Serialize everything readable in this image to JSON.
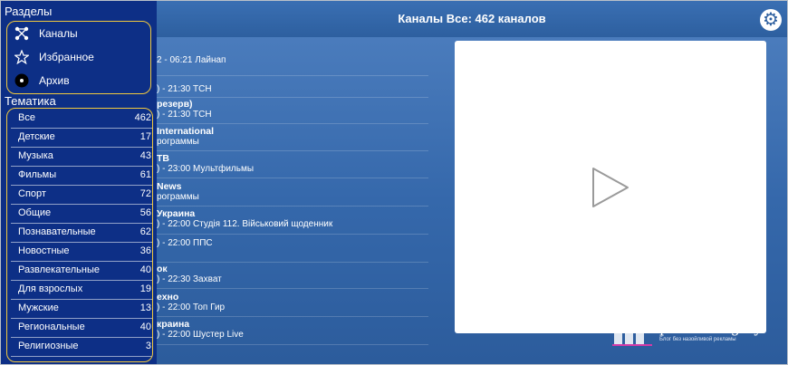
{
  "header": {
    "title": "Каналы Все: 462 каналов",
    "settings_icon": "gear-icon"
  },
  "sidebar": {
    "sections_title": "Разделы",
    "nav": [
      {
        "label": "Каналы",
        "icon": "network-icon"
      },
      {
        "label": "Избранное",
        "icon": "star-icon"
      },
      {
        "label": "Архив",
        "icon": "disc-icon"
      }
    ],
    "topics_title": "Тематика",
    "categories": [
      {
        "label": "Все",
        "count": "462"
      },
      {
        "label": "Детские",
        "count": "17"
      },
      {
        "label": "Музыка",
        "count": "43"
      },
      {
        "label": "Фильмы",
        "count": "61"
      },
      {
        "label": "Спорт",
        "count": "72"
      },
      {
        "label": "Общие",
        "count": "56"
      },
      {
        "label": "Познавательные",
        "count": "62"
      },
      {
        "label": "Новостные",
        "count": "36"
      },
      {
        "label": "Развлекательные",
        "count": "40"
      },
      {
        "label": "Для взрослых",
        "count": "19"
      },
      {
        "label": "Мужские",
        "count": "13"
      },
      {
        "label": "Региональные",
        "count": "40"
      },
      {
        "label": "Религиозные",
        "count": "3"
      }
    ]
  },
  "channels": [
    {
      "name": "",
      "program": "2 - 06:21 Лайнап"
    },
    {
      "name": "",
      "program": ") - 21:30 ТСН"
    },
    {
      "name": "резерв)",
      "program": ") - 21:30 ТСН"
    },
    {
      "name": "International",
      "program": "рограммы"
    },
    {
      "name": "ТВ",
      "program": ") - 23:00 Мультфильмы"
    },
    {
      "name": "News",
      "program": "рограммы"
    },
    {
      "name": "Украина",
      "program": ") - 22:00 Студія 112. Військовий щоденник"
    },
    {
      "name": "",
      "program": ") - 22:00 ППС"
    },
    {
      "name": "ок",
      "program": ") - 22:30 Захват"
    },
    {
      "name": "ехно",
      "program": ") - 22:00 Топ Гир"
    },
    {
      "name": "краина",
      "program": ") - 22:00 Шустер Live"
    }
  ],
  "player": {
    "icon": "play-icon"
  },
  "watermark": {
    "text": "pronetblog.by",
    "subtitle": "Блог без назойливой рекламы"
  },
  "colors": {
    "accent": "#f1c93e",
    "sidebar": "#0d2f86",
    "header": "#2d5f9f"
  }
}
